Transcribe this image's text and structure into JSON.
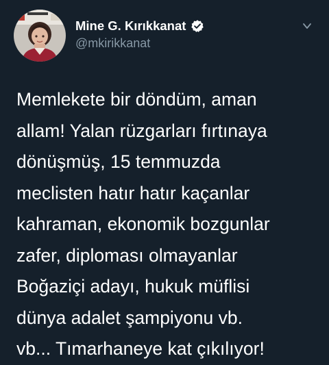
{
  "user": {
    "display_name": "Mine G. Kırıkkanat",
    "handle": "@mkirikkanat",
    "verified": true,
    "avatar_icon": "profile-photo"
  },
  "tweet": {
    "lines": [
      "Memlekete bir döndüm, aman",
      "allam! Yalan rüzgarları fırtınaya",
      "dönüşmüş, 15 temmuzda",
      "meclisten hatır hatır kaçanlar",
      "kahraman, ekonomik bozgunlar",
      "zafer, diploması olmayanlar",
      "Boğaziçi adayı, hukuk müflisi",
      "dünya adalet şampiyonu vb.",
      "vb... Tımarhaneye kat çıkılıyor!"
    ]
  },
  "colors": {
    "background": "#15202b",
    "text": "#ffffff",
    "secondary_text": "#8899a6",
    "verified_badge": "#ffffff"
  },
  "icons": {
    "verified": "verified-badge-icon",
    "menu": "chevron-down-icon"
  }
}
